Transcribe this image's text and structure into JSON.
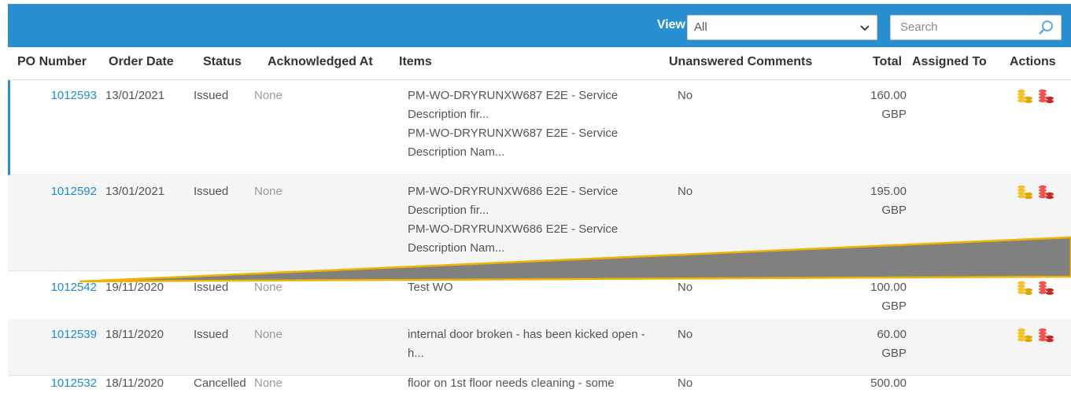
{
  "toolbar": {
    "view_label": "View",
    "view_value": "All",
    "search_placeholder": "Search"
  },
  "columns": {
    "po": "PO Number",
    "date": "Order Date",
    "status": "Status",
    "ack": "Acknowledged At",
    "items": "Items",
    "comments": "Unanswered Comments",
    "total": "Total",
    "assigned": "Assigned To",
    "actions": "Actions"
  },
  "rows": [
    {
      "po": "1012593",
      "date": "13/01/2021",
      "status": "Issued",
      "ack": "None",
      "items": [
        "PM-WO-DRYRUNXW687 E2E - Service Description fir...",
        "PM-WO-DRYRUNXW687 E2E - Service Description Nam..."
      ],
      "comments": "No",
      "total_amount": "160.00",
      "total_currency": "GBP"
    },
    {
      "po": "1012592",
      "date": "13/01/2021",
      "status": "Issued",
      "ack": "None",
      "items": [
        "PM-WO-DRYRUNXW686 E2E - Service Description fir...",
        "PM-WO-DRYRUNXW686 E2E - Service Description Nam..."
      ],
      "comments": "No",
      "total_amount": "195.00",
      "total_currency": "GBP"
    },
    {
      "po": "1012542",
      "date": "19/11/2020",
      "status": "Issued",
      "ack": "None",
      "items": [
        "Test WO"
      ],
      "comments": "No",
      "total_amount": "100.00",
      "total_currency": "GBP"
    },
    {
      "po": "1012539",
      "date": "18/11/2020",
      "status": "Issued",
      "ack": "None",
      "items": [
        "internal door broken - has been kicked open - h..."
      ],
      "comments": "No",
      "total_amount": "60.00",
      "total_currency": "GBP"
    },
    {
      "po": "1012532",
      "date": "18/11/2020",
      "status": "Cancelled",
      "ack": "None",
      "items": [
        "floor on 1st floor needs cleaning - some"
      ],
      "comments": "No",
      "total_amount": "500.00",
      "total_currency": ""
    }
  ],
  "colors": {
    "header_bg": "#2a8fd1",
    "link": "#1e8cd0",
    "coin_gold": "#f2c230",
    "coin_red": "#e53935",
    "overlay_fill": "#808080",
    "overlay_stroke": "#f0b400"
  },
  "icons": {
    "search": "magnifier-icon",
    "dropdown": "chevron-down-icon",
    "action_a": "gold-coins-icon",
    "action_b": "red-coins-icon"
  }
}
